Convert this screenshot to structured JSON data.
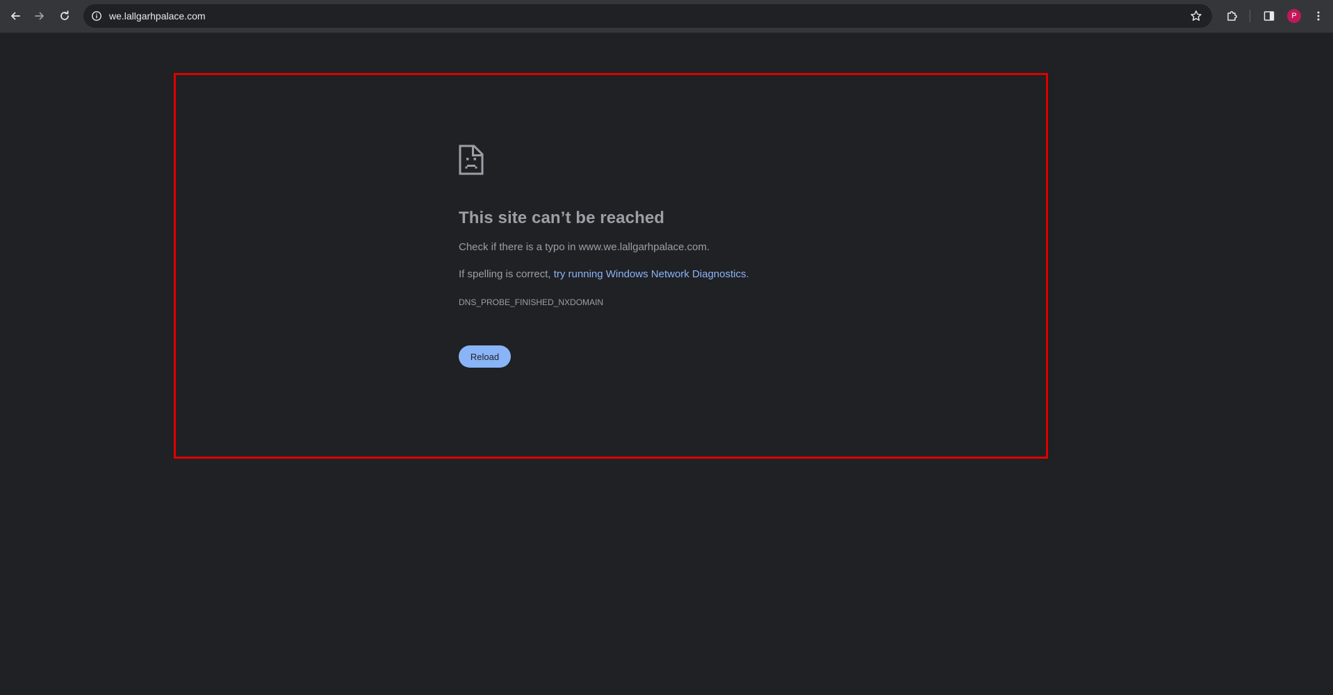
{
  "browser": {
    "url": "we.lallgarhpalace.com",
    "avatar_initial": "P"
  },
  "error": {
    "title": "This site can’t be reached",
    "typo_text": "Check if there is a typo in www.we.lallgarhpalace.com.",
    "spelling_prefix": "If spelling is correct, ",
    "diagnostics_link": "try running Windows Network Diagnostics",
    "spelling_suffix": ".",
    "error_code": "DNS_PROBE_FINISHED_NXDOMAIN",
    "reload_label": "Reload"
  },
  "icons": {
    "back": "back-arrow-icon",
    "forward": "forward-arrow-icon",
    "reload": "reload-icon",
    "site_info": "info-icon",
    "bookmark": "star-icon",
    "extensions": "puzzle-icon",
    "side_panel": "side-panel-icon",
    "menu": "kebab-menu-icon",
    "error": "sad-document-icon"
  },
  "colors": {
    "page_background": "#202124",
    "toolbar": "#35363a",
    "link": "#8ab4f8",
    "highlight_frame": "#e00000",
    "avatar": "#c2185b"
  }
}
